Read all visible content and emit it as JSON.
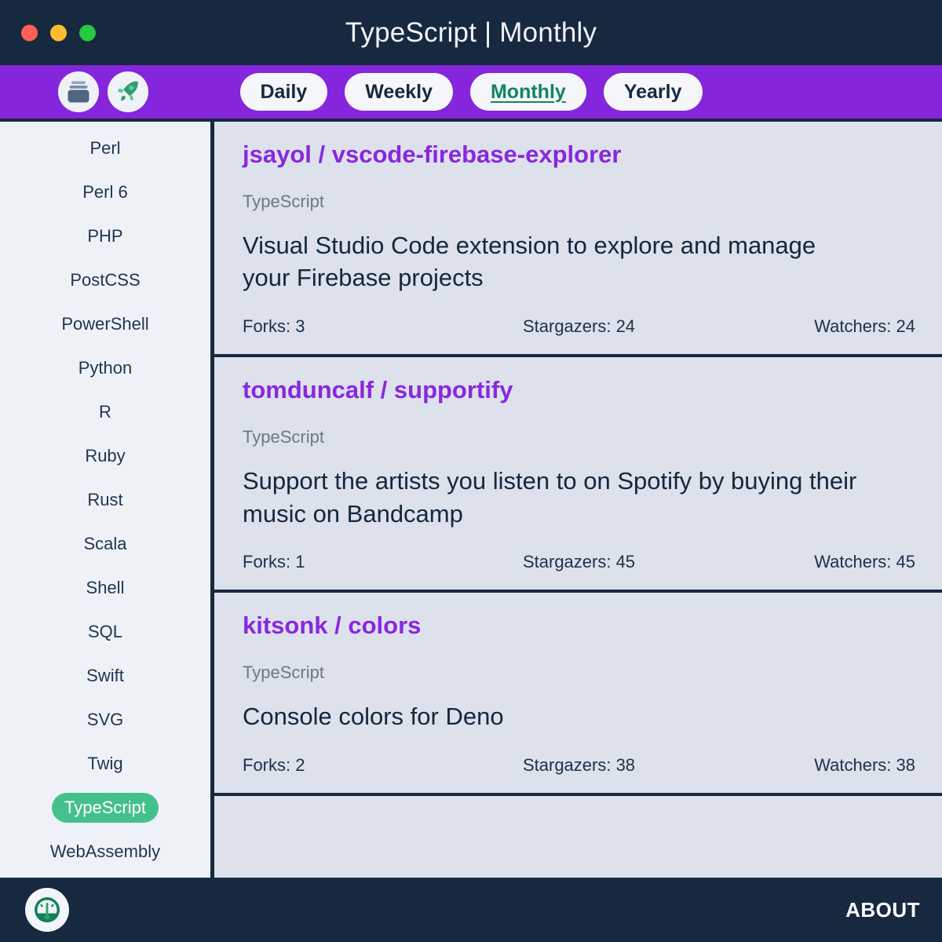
{
  "window": {
    "title": "TypeScript | Monthly",
    "traffic_lights": [
      {
        "name": "close",
        "color": "#ff5f57"
      },
      {
        "name": "minimize",
        "color": "#febc2e"
      },
      {
        "name": "maximize",
        "color": "#28c840"
      }
    ]
  },
  "colors": {
    "titlebar_bg": "#16293f",
    "toolbar_purple": "#8526dc",
    "sidebar_bg": "#eef2f7",
    "content_bg": "#dce1ec",
    "repo_link": "#8a27dd",
    "active_pill_text": "#11855e",
    "active_lang_bg": "#45c08d"
  },
  "toolbar": {
    "icons": [
      {
        "name": "archive-icon",
        "label": "Archive"
      },
      {
        "name": "rocket-icon",
        "label": "Trending"
      }
    ],
    "pills": [
      {
        "label": "Daily",
        "active": false
      },
      {
        "label": "Weekly",
        "active": false
      },
      {
        "label": "Monthly",
        "active": true
      },
      {
        "label": "Yearly",
        "active": false
      }
    ]
  },
  "sidebar": {
    "items": [
      {
        "label": "Perl",
        "active": false
      },
      {
        "label": "Perl 6",
        "active": false
      },
      {
        "label": "PHP",
        "active": false
      },
      {
        "label": "PostCSS",
        "active": false
      },
      {
        "label": "PowerShell",
        "active": false
      },
      {
        "label": "Python",
        "active": false
      },
      {
        "label": "R",
        "active": false
      },
      {
        "label": "Ruby",
        "active": false
      },
      {
        "label": "Rust",
        "active": false
      },
      {
        "label": "Scala",
        "active": false
      },
      {
        "label": "Shell",
        "active": false
      },
      {
        "label": "SQL",
        "active": false
      },
      {
        "label": "Swift",
        "active": false
      },
      {
        "label": "SVG",
        "active": false
      },
      {
        "label": "Twig",
        "active": false
      },
      {
        "label": "TypeScript",
        "active": true
      },
      {
        "label": "WebAssembly",
        "active": false
      }
    ]
  },
  "repos": [
    {
      "title": "jsayol / vscode-firebase-explorer",
      "language": "TypeScript",
      "description": "Visual Studio Code extension to explore and manage your Firebase projects",
      "forks": "Forks: 3",
      "stargazers": "Stargazers: 24",
      "watchers": "Watchers: 24"
    },
    {
      "title": "tomduncalf / supportify",
      "language": "TypeScript",
      "description": "Support the artists you listen to on Spotify by buying their music on Bandcamp",
      "forks": "Forks: 1",
      "stargazers": "Stargazers: 45",
      "watchers": "Watchers: 45"
    },
    {
      "title": "kitsonk / colors",
      "language": "TypeScript",
      "description": "Console colors for Deno",
      "forks": "Forks: 2",
      "stargazers": "Stargazers: 38",
      "watchers": "Watchers: 38"
    }
  ],
  "footer": {
    "logo_icon": "gauge-icon",
    "about_label": "ABOUT"
  }
}
